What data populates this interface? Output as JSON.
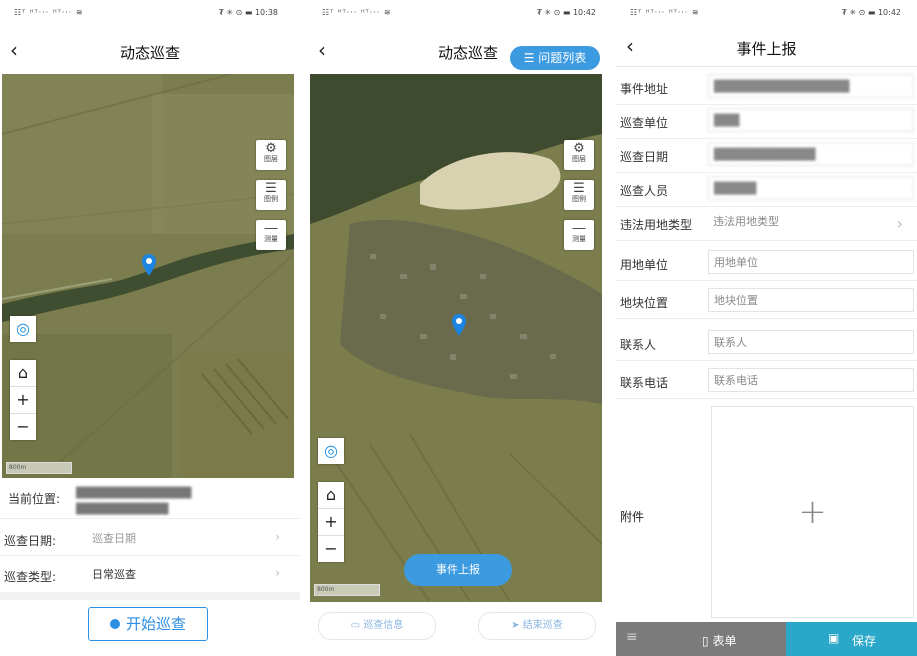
{
  "status": {
    "left": "☷ᵀ ᴴᵀ‧‧‧ ᴴᵀ‧‧‧ ≋",
    "icons": "₮ ✳ ⊙ ▬",
    "time1": "10:38",
    "time2": "10:42",
    "time3": "10:42"
  },
  "panel1": {
    "title": "动态巡查",
    "location_label": "当前位置:",
    "location_value_line1": "███████████████",
    "location_value_line2": "████████████",
    "date_label": "巡查日期:",
    "date_placeholder": "巡查日期",
    "type_label": "巡查类型:",
    "type_value": "日常巡查",
    "start_button": "开始巡查",
    "scale_text": "800m"
  },
  "panel2": {
    "title": "动态巡查",
    "issue_list_button": "问题列表",
    "report_button": "事件上报",
    "bottom_left": "巡查信息",
    "bottom_right": "结束巡查",
    "scale_text": "800m"
  },
  "panel3": {
    "title": "事件上报",
    "fields": [
      {
        "label": "事件地址",
        "value": "████████████████"
      },
      {
        "label": "巡查单位",
        "value": "███"
      },
      {
        "label": "巡查日期",
        "value": "████████████"
      },
      {
        "label": "巡查人员",
        "value": "█████"
      },
      {
        "label": "违法用地类型",
        "value": "违法用地类型"
      },
      {
        "label": "用地单位",
        "value": "用地单位"
      },
      {
        "label": "地块位置",
        "value": "地块位置"
      },
      {
        "label": "联系人",
        "value": "联系人"
      },
      {
        "label": "联系电话",
        "value": "联系电话"
      }
    ],
    "attachment_label": "附件",
    "form_tab": "表单",
    "save_button": "保存"
  },
  "map_tools": {
    "layer_label": "图层",
    "legend_label": "图例",
    "measure_label": "测量"
  },
  "colors": {
    "accent": "#3c9ae0",
    "save_bar": "#2aa7c9",
    "bottom_bar": "#7b7b7b"
  }
}
